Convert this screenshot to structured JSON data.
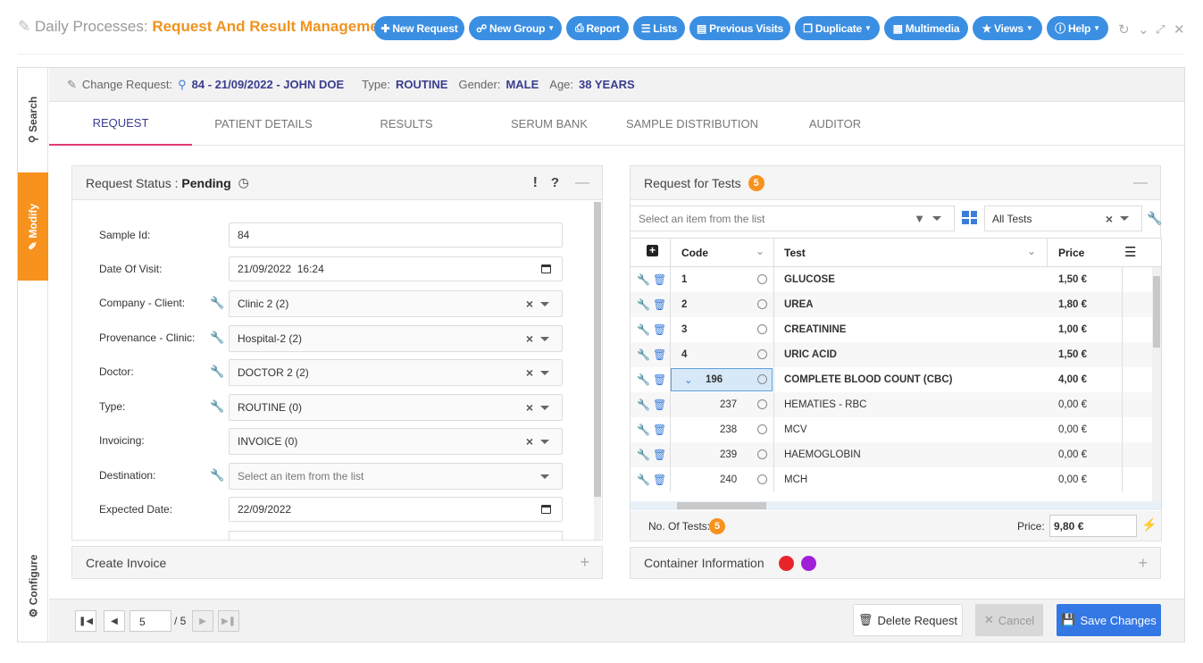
{
  "header": {
    "title_prefix": "Daily Processes:",
    "title_accent": "Request And Result Management",
    "buttons": [
      {
        "label": "New Request",
        "icon": "plus-icon"
      },
      {
        "label": "New Group",
        "icon": "sitemap-icon"
      },
      {
        "label": "Report",
        "icon": "print-icon"
      },
      {
        "label": "Lists",
        "icon": "list-icon"
      },
      {
        "label": "Previous Visits",
        "icon": "database-icon"
      },
      {
        "label": "Duplicate",
        "icon": "copy-icon"
      },
      {
        "label": "Multimedia",
        "icon": "film-icon"
      },
      {
        "label": "Views",
        "icon": "star-icon"
      },
      {
        "label": "Help",
        "icon": "info-icon"
      }
    ]
  },
  "sidebar": {
    "search": "Search",
    "modify": "Modify",
    "configure": "Configure"
  },
  "infobar": {
    "label": "Change Request:",
    "request": "84 - 21/09/2022 - JOHN DOE",
    "type_label": "Type:",
    "type_value": "ROUTINE",
    "gender_label": "Gender:",
    "gender_value": "MALE",
    "age_label": "Age:",
    "age_value": "38 YEARS"
  },
  "tabs": [
    "REQUEST",
    "PATIENT DETAILS",
    "RESULTS",
    "SERUM BANK",
    "SAMPLE DISTRIBUTION",
    "AUDITOR"
  ],
  "status_panel": {
    "title": "Request Status :",
    "status": "Pending"
  },
  "form": {
    "sample_id_label": "Sample Id:",
    "sample_id": "84",
    "date_label": "Date Of Visit:",
    "date": "21/09/2022  16:24",
    "company_label": "Company - Client:",
    "company": "Clinic 2 (2)",
    "provenance_label": "Provenance - Clinic:",
    "provenance": "Hospital-2 (2)",
    "doctor_label": "Doctor:",
    "doctor": "DOCTOR 2 (2)",
    "type_label": "Type:",
    "type": "ROUTINE (0)",
    "invoicing_label": "Invoicing:",
    "invoicing": "INVOICE (0)",
    "destination_label": "Destination:",
    "destination_placeholder": "Select an item from the list",
    "expected_label": "Expected Date:",
    "expected": "22/09/2022"
  },
  "create_invoice": "Create Invoice",
  "tests_panel": {
    "title": "Request for Tests",
    "count": "5",
    "select_placeholder": "Select an item from the list",
    "filter_value": "All Tests",
    "col_code": "Code",
    "col_test": "Test",
    "col_price": "Price",
    "rows": [
      {
        "code": "1",
        "test": "GLUCOSE",
        "price": "1,50 €",
        "bold": true
      },
      {
        "code": "2",
        "test": "UREA",
        "price": "1,80 €",
        "bold": true
      },
      {
        "code": "3",
        "test": "CREATININE",
        "price": "1,00 €",
        "bold": true
      },
      {
        "code": "4",
        "test": "URIC ACID",
        "price": "1,50 €",
        "bold": true
      },
      {
        "code": "196",
        "test": "COMPLETE BLOOD COUNT (CBC)",
        "price": "4,00 €",
        "bold": true
      },
      {
        "code": "237",
        "test": "HEMATIES - RBC",
        "price": "0,00 €",
        "bold": false
      },
      {
        "code": "238",
        "test": "MCV",
        "price": "0,00 €",
        "bold": false
      },
      {
        "code": "239",
        "test": "HAEMOGLOBIN",
        "price": "0,00 €",
        "bold": false
      },
      {
        "code": "240",
        "test": "MCH",
        "price": "0,00 €",
        "bold": false
      }
    ],
    "no_tests_label": "No. Of Tests:",
    "no_tests": "5",
    "price_label": "Price:",
    "price_total": "9,80 €"
  },
  "container_info": "Container Information",
  "container_colors": [
    "#e8242b",
    "#a020d8"
  ],
  "pager": {
    "current": "5",
    "total": "/ 5"
  },
  "actions": {
    "delete": "Delete Request",
    "cancel": "Cancel",
    "save": "Save Changes"
  },
  "colors": {
    "accent_orange": "#f7921e",
    "primary_blue": "#3b8fe2",
    "header_navy": "#3a3d8f"
  }
}
